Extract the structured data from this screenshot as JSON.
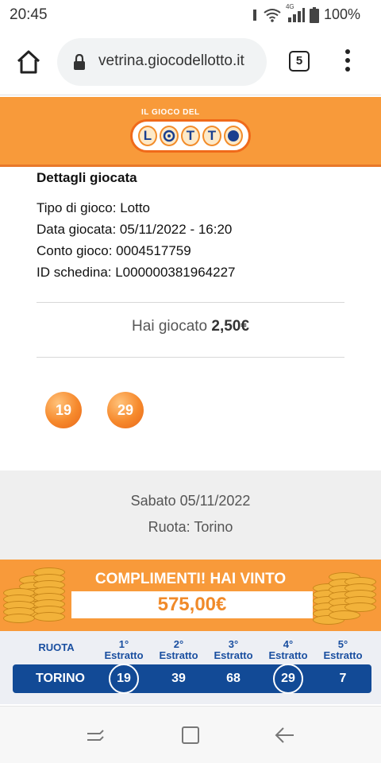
{
  "status_bar": {
    "time": "20:45",
    "network_label": "4G",
    "battery": "100%",
    "icons": [
      "vibrate-icon",
      "wifi-icon",
      "signal-icon",
      "battery-icon"
    ]
  },
  "browser": {
    "url": "vetrina.giocodellotto.it",
    "tab_count": "5",
    "icons": [
      "home-icon",
      "lock-icon",
      "more-vert-icon"
    ]
  },
  "header": {
    "logo_top_text": "IL GIOCO DEL",
    "logo_letters": [
      "L",
      "T",
      "T"
    ],
    "brand_colors": {
      "orange": "#f89a3a",
      "blue": "#1a3f8f"
    }
  },
  "details": {
    "title": "Dettagli giocata",
    "lines": [
      "Tipo di gioco: Lotto",
      "Data giocata: 05/11/2022 - 16:20",
      "Conto gioco: 0004517759",
      "ID schedina: L000000381964227"
    ],
    "played_label": "Hai giocato",
    "played_amount": "2,50€",
    "numbers": [
      "19",
      "29"
    ]
  },
  "draw": {
    "date": "Sabato 05/11/2022",
    "wheel": "Ruota: Torino"
  },
  "win": {
    "title": "COMPLIMENTI! HAI VINTO",
    "amount": "575,00€"
  },
  "results": {
    "headers": [
      {
        "line1": "RUOTA",
        "line2": ""
      },
      {
        "line1": "1°",
        "line2": "Estratto"
      },
      {
        "line1": "2°",
        "line2": "Estratto"
      },
      {
        "line1": "3°",
        "line2": "Estratto"
      },
      {
        "line1": "4°",
        "line2": "Estratto"
      },
      {
        "line1": "5°",
        "line2": "Estratto"
      }
    ],
    "row": {
      "wheel": "TORINO",
      "numbers": [
        "19",
        "39",
        "68",
        "29",
        "7"
      ],
      "matched": [
        "19",
        "29"
      ]
    }
  },
  "nav": {
    "icons": [
      "recent-apps-icon",
      "home-square-icon",
      "back-arrow-icon"
    ]
  }
}
